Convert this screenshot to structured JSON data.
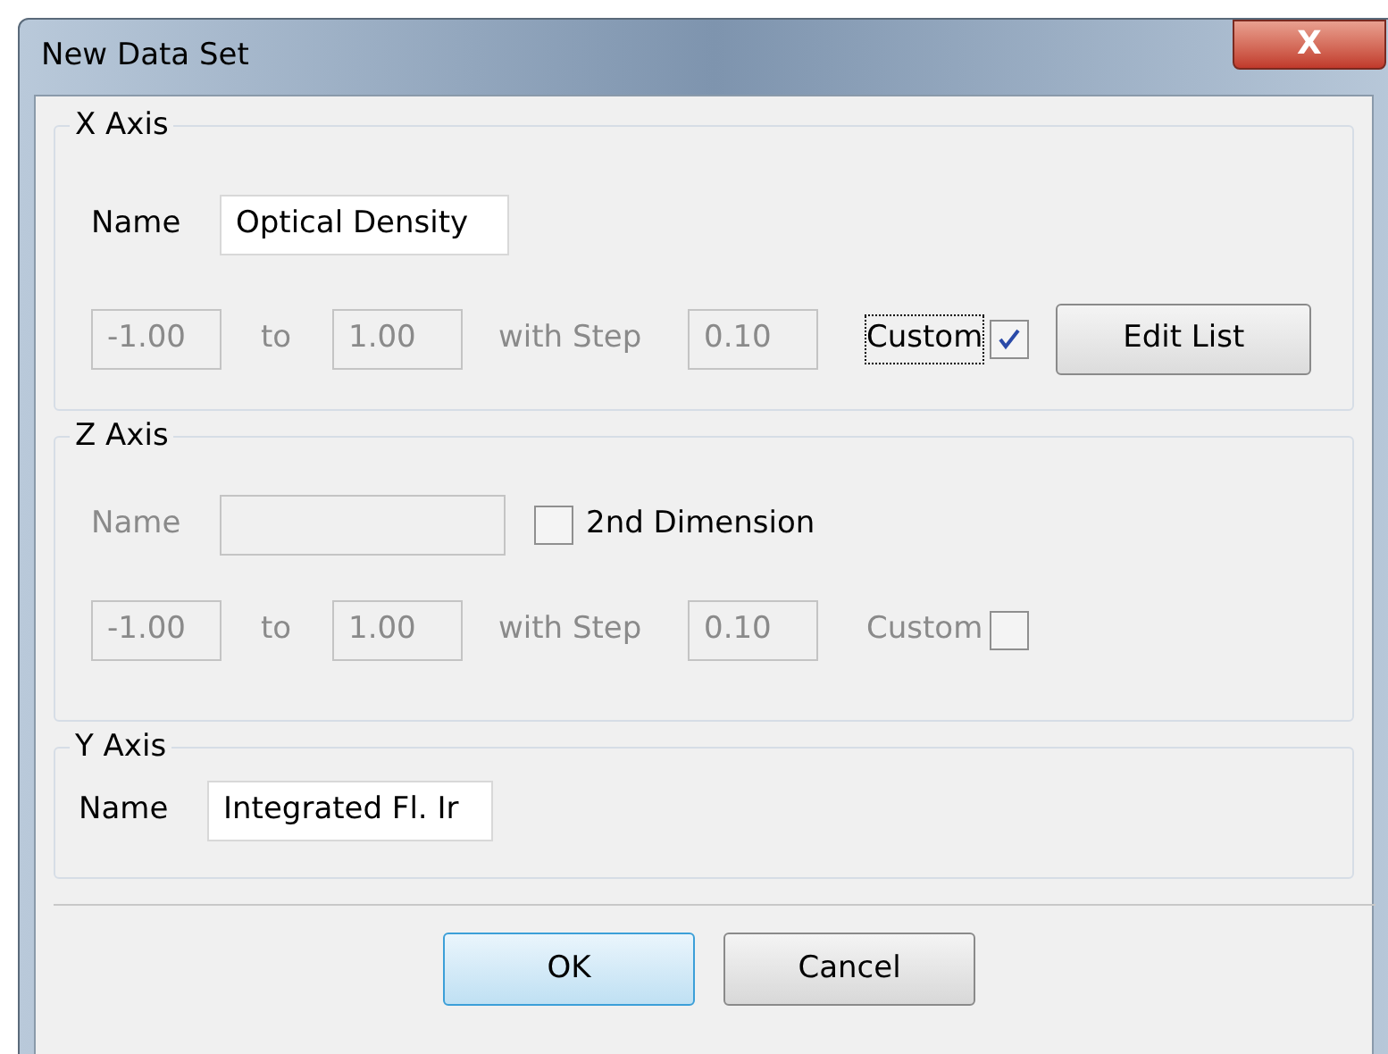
{
  "window": {
    "title": "New Data Set",
    "close": "X"
  },
  "x_axis": {
    "title": "X Axis",
    "name_label": "Name",
    "name_value": "Optical Density",
    "name_disabled": false,
    "range": {
      "from": "-1.00",
      "to_label": "to",
      "to": "1.00",
      "step_label": "with Step",
      "step": "0.10",
      "disabled": true
    },
    "custom": {
      "label": "Custom",
      "checked": true,
      "disabled": false,
      "focused": true
    },
    "edit_button": "Edit List"
  },
  "z_axis": {
    "title": "Z Axis",
    "name_label": "Name",
    "name_disabled": true,
    "second_dimension": {
      "label": "2nd Dimension",
      "checked": false
    },
    "range": {
      "from": "-1.00",
      "to_label": "to",
      "to": "1.00",
      "step_label": "with Step",
      "step": "0.10",
      "disabled": true
    },
    "custom": {
      "label": "Custom",
      "checked": false,
      "disabled": true,
      "focused": false
    }
  },
  "y_axis": {
    "title": "Y Axis",
    "name_label": "Name",
    "name_value": "Integrated Fl. Ir"
  },
  "buttons": [
    {
      "label": "OK",
      "default": true
    },
    {
      "label": "Cancel",
      "default": false
    }
  ]
}
